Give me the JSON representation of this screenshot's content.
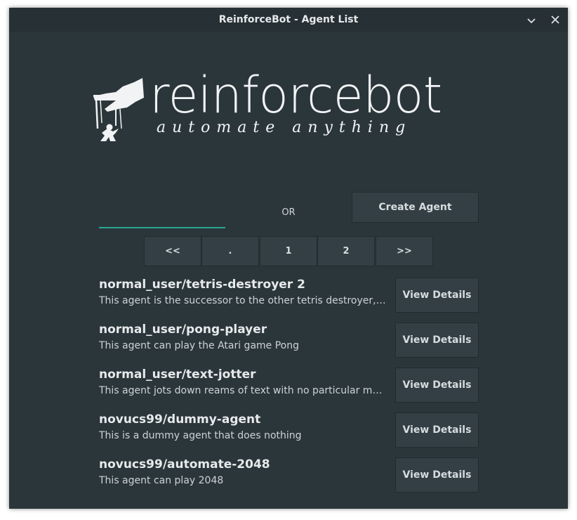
{
  "window": {
    "title": "ReinforceBot - Agent List",
    "minimize_glyph": "⌄",
    "close_glyph": "✕"
  },
  "logo": {
    "wordmark": "reinforcebot",
    "tagline": "automate anything",
    "icon": "puppet-hand-icon"
  },
  "search": {
    "value": "",
    "placeholder": ""
  },
  "or_label": "OR",
  "create_button": "Create Agent",
  "pagination": [
    "<<",
    ".",
    "1",
    "2",
    ">>"
  ],
  "agents": [
    {
      "name": "normal_user/tetris-destroyer 2",
      "description": "This agent is the successor to the other tetris destroyer, a…",
      "button": "View Details"
    },
    {
      "name": "normal_user/pong-player",
      "description": "This agent can play the Atari game Pong",
      "button": "View Details"
    },
    {
      "name": "normal_user/text-jotter",
      "description": "This agent jots down reams of text with no particular motive",
      "button": "View Details"
    },
    {
      "name": "novucs99/dummy-agent",
      "description": "This is a dummy agent that does nothing",
      "button": "View Details"
    },
    {
      "name": "novucs99/automate-2048",
      "description": "This agent can play 2048",
      "button": "View Details"
    }
  ],
  "colors": {
    "background": "#2b363b",
    "titlebar": "#263035",
    "button": "#333f45",
    "accent": "#2aa791",
    "text": "#e7eaeb"
  }
}
